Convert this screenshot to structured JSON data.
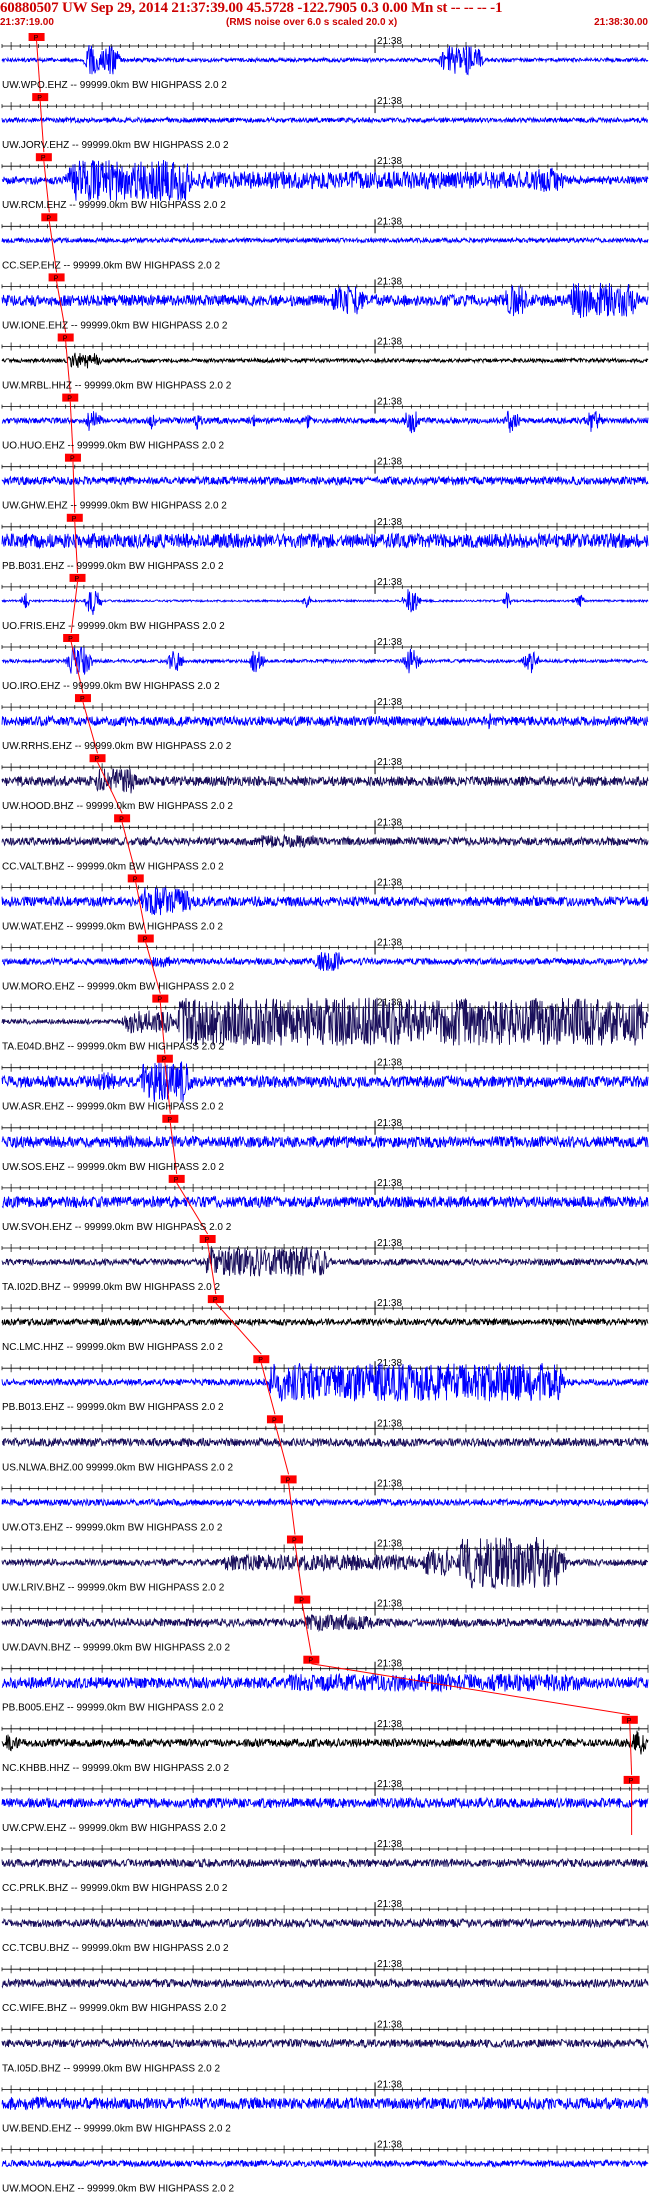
{
  "header": {
    "event_id": "60880507",
    "network": "UW",
    "date": "Sep 29, 2014",
    "time": "21:37:39.00",
    "lat": "45.5728",
    "lon": "-122.7905",
    "depth": "0.3",
    "mag": "0.00",
    "mag_type": "Mn",
    "event_type": "st",
    "suffix": "-- -- -- -1",
    "title": "60880507 UW Sep 29, 2014 21:37:39.00   45.5728 -122.7905  0.3 0.00 Mn st -- -- -- -1",
    "start_time": "21:37:19.00",
    "end_time": "21:38:30.00",
    "noise_note": "(RMS noise over 6.0 s scaled 20.0 x)"
  },
  "chart_data": {
    "type": "seismogram-record-section",
    "time_axis": {
      "start": "21:37:19.00",
      "end": "21:38:30.00",
      "duration_s": 71,
      "minute_mark": "21:38",
      "minute_mark_offset_s": 41
    },
    "filter_label": "99999.0km BW  HIGHPASS  2.0  2",
    "pick_label": "P",
    "colors": {
      "blue": "#0000ff",
      "navy": "#1a0f5c",
      "black": "#000000",
      "pick": "#ff0000",
      "axis": "#000000"
    },
    "traces": [
      {
        "station": "UW.WPO.EHZ",
        "label": "UW.WPO.EHZ -- 99999.0km BW  HIGHPASS  2.0  2",
        "color": "blue",
        "pick_s": 3.8,
        "noise": 0.12,
        "bursts": [
          [
            9,
            13,
            1.0
          ],
          [
            48,
            53,
            0.9
          ]
        ]
      },
      {
        "station": "UW.JORV.EHZ",
        "label": "UW.JORV.EHZ -- 99999.0km BW  HIGHPASS  2.0  2",
        "color": "blue",
        "pick_s": 4.2,
        "noise": 0.15,
        "bursts": []
      },
      {
        "station": "UW.RCM.EHZ",
        "label": "UW.RCM.EHZ -- 99999.0km BW  HIGHPASS  2.0  2",
        "color": "blue",
        "pick_s": 4.6,
        "noise": 0.25,
        "bursts": [
          [
            7,
            21,
            1.3
          ],
          [
            21,
            62,
            0.55
          ],
          [
            58,
            62,
            0.8
          ]
        ]
      },
      {
        "station": "CC.SEP.EHZ",
        "label": "CC.SEP.EHZ -- 99999.0km BW  HIGHPASS  2.0  2",
        "color": "blue",
        "pick_s": 5.2,
        "noise": 0.14,
        "bursts": []
      },
      {
        "station": "UW.IONE.EHZ",
        "label": "UW.IONE.EHZ -- 99999.0km BW  HIGHPASS  2.0  2",
        "color": "blue",
        "pick_s": 6.0,
        "noise": 0.35,
        "bursts": [
          [
            36,
            40,
            0.9
          ],
          [
            55,
            58,
            1.0
          ],
          [
            62,
            70,
            1.1
          ]
        ]
      },
      {
        "station": "UW.MRBL.HHZ",
        "label": "UW.MRBL.HHZ -- 99999.0km BW  HIGHPASS  2.0  2",
        "color": "black",
        "pick_s": 7.0,
        "noise": 0.12,
        "bursts": [
          [
            7,
            11,
            0.5
          ]
        ]
      },
      {
        "station": "UO.HUO.EHZ",
        "label": "UO.HUO.EHZ -- 99999.0km BW  HIGHPASS  2.0  2",
        "color": "blue",
        "pick_s": 7.5,
        "noise": 0.18,
        "bursts": [
          [
            9,
            11,
            0.7
          ],
          [
            16,
            17,
            0.8
          ],
          [
            21,
            22,
            0.8
          ],
          [
            27,
            28,
            0.8
          ],
          [
            33,
            34,
            0.8
          ],
          [
            44,
            46,
            0.8
          ],
          [
            55,
            57,
            0.8
          ],
          [
            64,
            66,
            0.8
          ]
        ]
      },
      {
        "station": "UW.GHW.EHZ",
        "label": "UW.GHW.EHZ -- 99999.0km BW  HIGHPASS  2.0  2",
        "color": "blue",
        "pick_s": 7.8,
        "noise": 0.25,
        "bursts": []
      },
      {
        "station": "PB.B031.EHZ",
        "label": "PB.B031.EHZ -- 99999.0km BW  HIGHPASS  2.0  2",
        "color": "blue",
        "pick_s": 8.0,
        "noise": 0.45,
        "bursts": []
      },
      {
        "station": "UO.FRIS.EHZ",
        "label": "UO.FRIS.EHZ -- 99999.0km BW  HIGHPASS  2.0  2",
        "color": "blue",
        "pick_s": 8.3,
        "noise": 0.06,
        "bursts": [
          [
            2,
            3,
            0.8
          ],
          [
            9,
            11,
            0.9
          ],
          [
            33,
            34,
            0.7
          ],
          [
            44,
            46,
            0.8
          ],
          [
            55,
            56,
            0.8
          ],
          [
            63,
            64,
            0.7
          ]
        ]
      },
      {
        "station": "UO.IRO.EHZ",
        "label": "UO.IRO.EHZ -- 99999.0km BW  HIGHPASS  2.0  2",
        "color": "blue",
        "pick_s": 7.6,
        "noise": 0.1,
        "bursts": [
          [
            7,
            10,
            0.9
          ],
          [
            18,
            20,
            0.7
          ],
          [
            27,
            29,
            0.7
          ],
          [
            44,
            46,
            0.8
          ],
          [
            57,
            59,
            0.8
          ]
        ]
      },
      {
        "station": "UW.RRHS.EHZ",
        "label": "UW.RRHS.EHZ -- 99999.0km BW  HIGHPASS  2.0  2",
        "color": "blue",
        "pick_s": 8.9,
        "noise": 0.3,
        "bursts": [
          [
            53,
            54,
            0.8
          ]
        ]
      },
      {
        "station": "UW.HOOD.BHZ",
        "label": "UW.HOOD.BHZ -- 99999.0km BW  HIGHPASS  2.0  2",
        "color": "navy",
        "pick_s": 10.5,
        "noise": 0.3,
        "bursts": [
          [
            10,
            15,
            0.8
          ]
        ]
      },
      {
        "station": "CC.VALT.BHZ",
        "label": "CC.VALT.BHZ -- 99999.0km BW  HIGHPASS  2.0  2",
        "color": "navy",
        "pick_s": 13.2,
        "noise": 0.25,
        "bursts": [
          [
            28,
            35,
            0.4
          ]
        ]
      },
      {
        "station": "UW.WAT.EHZ",
        "label": "UW.WAT.EHZ -- 99999.0km BW  HIGHPASS  2.0  2",
        "color": "blue",
        "pick_s": 14.7,
        "noise": 0.3,
        "bursts": [
          [
            15,
            21,
            0.9
          ]
        ]
      },
      {
        "station": "UW.MORO.EHZ",
        "label": "UW.MORO.EHZ -- 99999.0km BW  HIGHPASS  2.0  2",
        "color": "blue",
        "pick_s": 15.8,
        "noise": 0.2,
        "bursts": [
          [
            16,
            19,
            0.4
          ],
          [
            34,
            38,
            0.6
          ]
        ]
      },
      {
        "station": "TA.E04D.BHZ",
        "label": "TA.E04D.BHZ -- 99999.0km BW  HIGHPASS  2.0  2",
        "color": "navy",
        "pick_s": 17.4,
        "noise": 0.15,
        "bursts": [
          [
            13,
            19,
            0.7
          ],
          [
            19,
            71,
            1.5
          ]
        ]
      },
      {
        "station": "UW.ASR.EHZ",
        "label": "UW.ASR.EHZ -- 99999.0km BW  HIGHPASS  2.0  2",
        "color": "blue",
        "pick_s": 17.9,
        "noise": 0.35,
        "bursts": [
          [
            10,
            13,
            0.6
          ],
          [
            15,
            21,
            1.3
          ]
        ]
      },
      {
        "station": "UW.SOS.EHZ",
        "label": "UW.SOS.EHZ -- 99999.0km BW  HIGHPASS  2.0  2",
        "color": "blue",
        "pick_s": 18.5,
        "noise": 0.35,
        "bursts": []
      },
      {
        "station": "UW.SVOH.EHZ",
        "label": "UW.SVOH.EHZ -- 99999.0km BW  HIGHPASS  2.0  2",
        "color": "blue",
        "pick_s": 19.2,
        "noise": 0.35,
        "bursts": []
      },
      {
        "station": "TA.I02D.BHZ",
        "label": "TA.I02D.BHZ -- 99999.0km BW  HIGHPASS  2.0  2",
        "color": "navy",
        "pick_s": 22.6,
        "noise": 0.2,
        "bursts": [
          [
            22,
            36,
            0.9
          ]
        ]
      },
      {
        "station": "NC.LMC.HHZ",
        "label": "NC.LMC.HHZ -- 99999.0km BW  HIGHPASS  2.0  2",
        "color": "black",
        "pick_s": 23.5,
        "noise": 0.2,
        "bursts": []
      },
      {
        "station": "PB.B013.EHZ",
        "label": "PB.B013.EHZ -- 99999.0km BW  HIGHPASS  2.0  2",
        "color": "blue",
        "pick_s": 28.5,
        "noise": 0.2,
        "bursts": [
          [
            29,
            62,
            1.2
          ]
        ]
      },
      {
        "station": "US.NLWA.BHZ.00",
        "label": "US.NLWA.BHZ.00 99999.0km BW  HIGHPASS  2.0  2",
        "color": "navy",
        "pick_s": 30.0,
        "noise": 0.25,
        "bursts": []
      },
      {
        "station": "UW.OT3.EHZ",
        "label": "UW.OT3.EHZ -- 99999.0km BW  HIGHPASS  2.0  2",
        "color": "blue",
        "pick_s": 31.5,
        "noise": 0.2,
        "bursts": []
      },
      {
        "station": "UW.LRIV.BHZ",
        "label": "UW.LRIV.BHZ -- 99999.0km BW  HIGHPASS  2.0  2",
        "color": "navy",
        "pick_s": 32.2,
        "noise": 0.2,
        "bursts": [
          [
            24,
            46,
            0.5
          ],
          [
            46,
            50,
            0.8
          ],
          [
            50,
            62,
            1.6
          ]
        ]
      },
      {
        "station": "UW.DAVN.BHZ",
        "label": "UW.DAVN.BHZ -- 99999.0km BW  HIGHPASS  2.0  2",
        "color": "navy",
        "pick_s": 33.0,
        "noise": 0.25,
        "bursts": [
          [
            33,
            41,
            0.5
          ]
        ]
      },
      {
        "station": "PB.B005.EHZ",
        "label": "PB.B005.EHZ -- 99999.0km BW  HIGHPASS  2.0  2",
        "color": "blue",
        "pick_s": 34.0,
        "noise": 0.35,
        "bursts": [
          [
            31,
            64,
            0.55
          ]
        ]
      },
      {
        "station": "NC.KHBB.HHZ",
        "label": "NC.KHBB.HHZ -- 99999.0km BW  HIGHPASS  2.0  2",
        "color": "black",
        "pick_s": 69.0,
        "noise": 0.25,
        "bursts": [
          [
            0,
            2,
            0.6
          ],
          [
            69,
            71,
            0.8
          ]
        ]
      },
      {
        "station": "UW.CPW.EHZ",
        "label": "UW.CPW.EHZ -- 99999.0km BW  HIGHPASS  2.0  2",
        "color": "blue",
        "pick_s": 69.2,
        "noise": 0.3,
        "bursts": []
      },
      {
        "station": "CC.PRLK.BHZ",
        "label": "CC.PRLK.BHZ -- 99999.0km BW  HIGHPASS  2.0  2",
        "color": "navy",
        "pick_s": null,
        "noise": 0.25,
        "bursts": []
      },
      {
        "station": "CC.TCBU.BHZ",
        "label": "CC.TCBU.BHZ -- 99999.0km BW  HIGHPASS  2.0  2",
        "color": "navy",
        "pick_s": null,
        "noise": 0.25,
        "bursts": []
      },
      {
        "station": "CC.WIFE.BHZ",
        "label": "CC.WIFE.BHZ -- 99999.0km BW  HIGHPASS  2.0  2",
        "color": "navy",
        "pick_s": null,
        "noise": 0.25,
        "bursts": []
      },
      {
        "station": "TA.I05D.BHZ",
        "label": "TA.I05D.BHZ -- 99999.0km BW  HIGHPASS  2.0  2",
        "color": "navy",
        "pick_s": null,
        "noise": 0.25,
        "bursts": []
      },
      {
        "station": "UW.BEND.EHZ",
        "label": "UW.BEND.EHZ -- 99999.0km BW  HIGHPASS  2.0  2",
        "color": "blue",
        "pick_s": null,
        "noise": 0.35,
        "bursts": [
          [
            0,
            6,
            0.4
          ]
        ]
      },
      {
        "station": "UW.MOON.EHZ",
        "label": "UW.MOON.EHZ -- 99999.0km BW  HIGHPASS  2.0  2",
        "color": "blue",
        "pick_s": null,
        "noise": 0.2,
        "bursts": []
      }
    ]
  }
}
